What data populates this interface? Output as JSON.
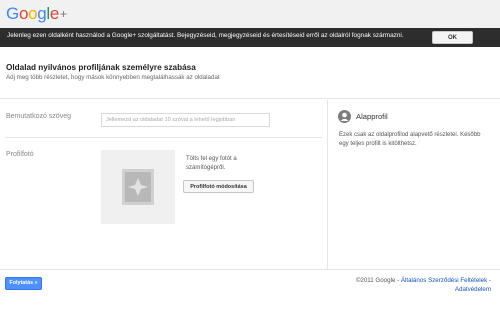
{
  "header": {
    "logo_letters": [
      "G",
      "o",
      "o",
      "g",
      "l",
      "e"
    ],
    "logo_plus": "+"
  },
  "notice": {
    "text": "Jelenleg ezen oldalként használod a Google+ szolgáltatást. Bejegyzéseid, megjegyzéseid és értesítéseid erről az oldalról fognak származni.",
    "ok_label": "OK"
  },
  "page": {
    "title": "Oldalad nyilvános profiljának személyre szabása",
    "subtitle": "Adj meg több részletet, hogy mások könnyebben megtalálhassák az oldaladat"
  },
  "form": {
    "intro_label": "Bemutatkozó szöveg",
    "intro_placeholder": "Jellemezd az oldaladat 10 szóval a lehető legjobban",
    "photo_label": "Profilfotó",
    "photo_hint": "Tölts fel egy fotót a számítógépről.",
    "photo_button": "Profilfotó módosítása"
  },
  "side": {
    "title": "Alapprofil",
    "description": "Ezek csak az oldalprofilod alapvető részletei. Később egy teljes profilt is kitölthetsz."
  },
  "footer": {
    "continue_label": "Folytatás »",
    "copyright": "©2011 Google - ",
    "terms_link": "Általános Szerződési Feltételek",
    "separator": " - ",
    "privacy_link": "Adatvédelem"
  },
  "colors": {
    "notice_bg": "#2d2d2d",
    "primary_button": "#4d90fe",
    "link": "#1155cc"
  },
  "icons": [
    "google-plus-logo",
    "image-placeholder-icon",
    "person-icon"
  ]
}
